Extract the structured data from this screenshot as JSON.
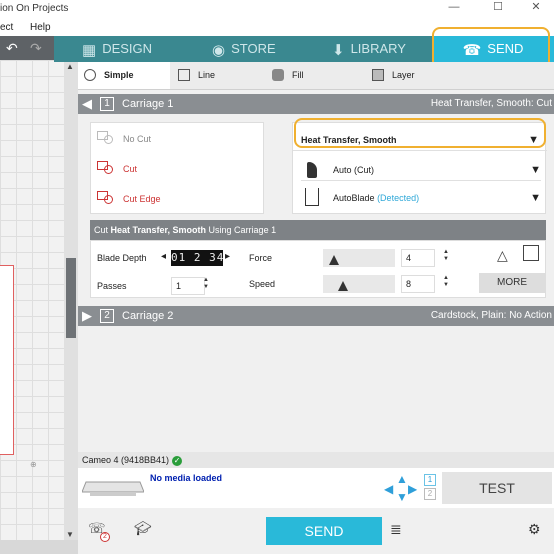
{
  "window": {
    "title": "ion On Projects"
  },
  "menu": {
    "items": [
      "ect",
      "Help"
    ]
  },
  "nav": {
    "tabs": [
      {
        "label": "DESIGN",
        "icon": "grid-icon"
      },
      {
        "label": "STORE",
        "icon": "store-s-icon"
      },
      {
        "label": "LIBRARY",
        "icon": "library-download-icon"
      },
      {
        "label": "SEND",
        "icon": "cutter-machine-icon"
      }
    ]
  },
  "modes": {
    "simple": "Simple",
    "line": "Line",
    "fill": "Fill",
    "layer": "Layer"
  },
  "carriage1": {
    "number": "1",
    "label": "Carriage 1",
    "material": "Heat Transfer, Smooth: Cut"
  },
  "cut_options": [
    "No Cut",
    "Cut",
    "Cut Edge"
  ],
  "material": {
    "selected": "Heat Transfer, Smooth",
    "action": "Auto (Cut)",
    "tool": "AutoBlade",
    "tool_status": "(Detected)"
  },
  "settings_bar": {
    "prefix": "Cut ",
    "material": "Heat Transfer, Smooth",
    "suffix": " Using Carriage 1"
  },
  "settings": {
    "blade_depth_label": "Blade Depth",
    "blade_depth_digits": "01 2 34",
    "force_label": "Force",
    "force": "4",
    "force_level": 0.1,
    "passes_label": "Passes",
    "passes": "1",
    "speed_label": "Speed",
    "speed": "8",
    "speed_level": 0.24,
    "more_label": "MORE"
  },
  "carriage2": {
    "number": "2",
    "label": "Carriage 2",
    "material": "Cardstock, Plain: No Action"
  },
  "device": {
    "name": "Cameo 4 (9418BB41)",
    "status_icon": "check-circle-icon",
    "media": "No media loaded",
    "test_label": "TEST",
    "carriage_nums": [
      "1",
      "2"
    ]
  },
  "footer": {
    "send_label": "SEND",
    "badge": "2"
  },
  "colors": {
    "accent": "#29b9d9",
    "nav_bg": "#3a8890",
    "highlight": "#f0b030",
    "cut_red": "#cc3333"
  }
}
